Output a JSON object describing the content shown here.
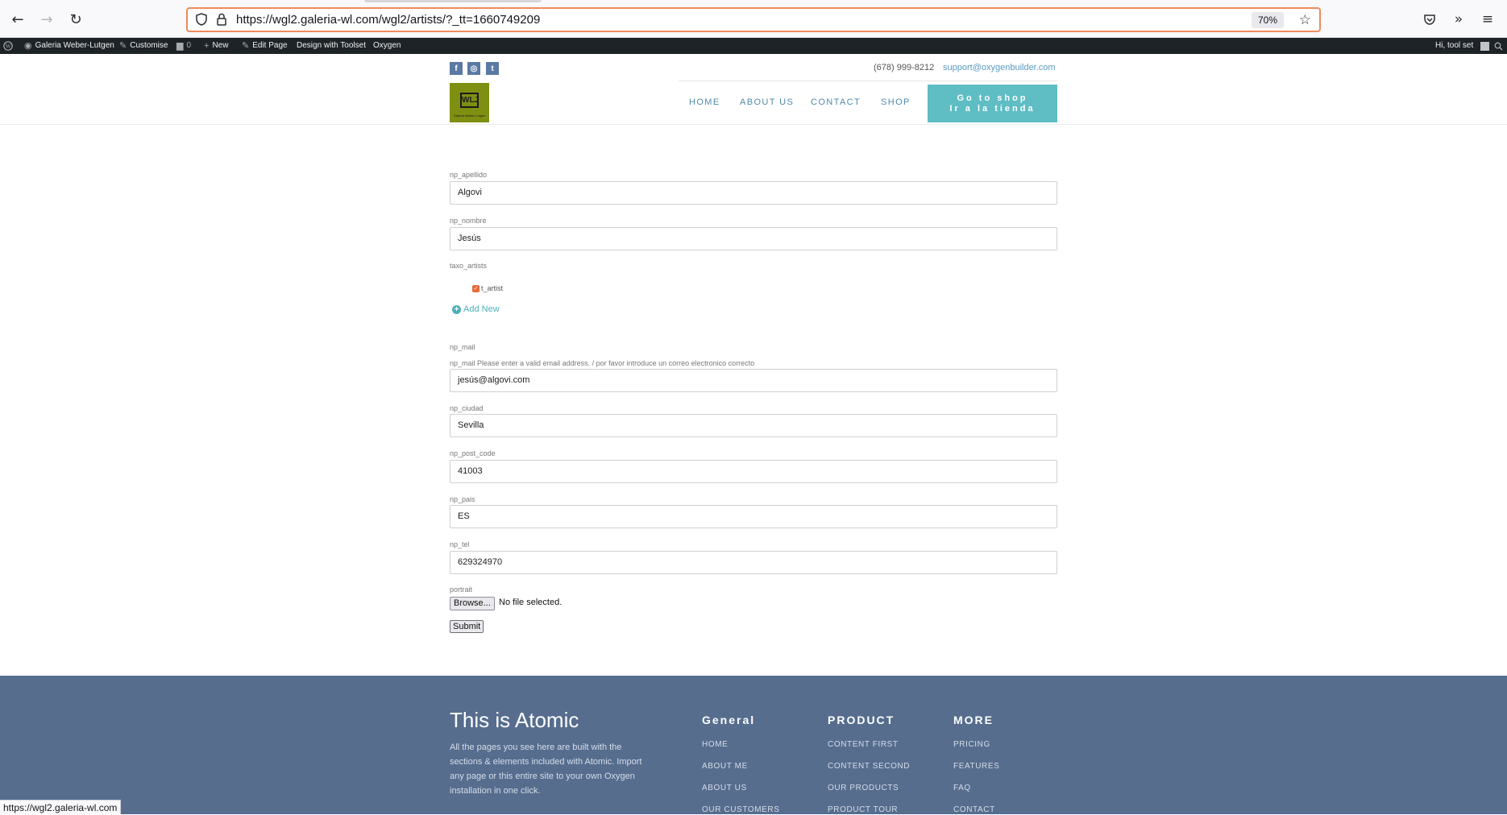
{
  "browser": {
    "url": "https://wgl2.galeria-wl.com/wgl2/artists/?_tt=1660749209",
    "zoom": "70%",
    "status_url": "https://wgl2.galeria-wl.com"
  },
  "admin_bar": {
    "site_name": "Galeria Weber-Lutgen",
    "customise": "Customise",
    "comments_count": "0",
    "new": "New",
    "edit_page": "Edit Page",
    "design_with_toolset": "Design with Toolset",
    "oxygen": "Oxygen",
    "greeting": "Hi, tool set"
  },
  "header": {
    "social": [
      "f",
      "◎",
      "t"
    ],
    "phone": "(678) 999-8212",
    "email": "support@oxygenbuilder.com",
    "logo_text": "WLJ",
    "logo_subtext": "Galería Weber-Lutgen",
    "nav": [
      "HOME",
      "ABOUT US",
      "CONTACT",
      "SHOP"
    ],
    "cta_line1": "Go to shop",
    "cta_line2": "Ir a la tienda"
  },
  "form": {
    "apellido_label": "np_apellido",
    "apellido_value": "Algovi",
    "nombre_label": "np_nombre",
    "nombre_value": "Jesús",
    "taxo_label": "taxo_artists",
    "taxo_option": "t_artist",
    "add_new": "Add New",
    "mail_heading": "np_mail",
    "mail_label": "np_mail Please enter a valid email address. / por favor introduce un correo electronico correcto",
    "mail_value": "jesús@algovi.com",
    "ciudad_label": "np_ciudad",
    "ciudad_value": "Sevilla",
    "post_code_label": "np_post_code",
    "post_code_value": "41003",
    "pais_label": "np_pais",
    "pais_value": "ES",
    "tel_label": "np_tel",
    "tel_value": "629324970",
    "portrait_label": "portrait",
    "browse": "Browse...",
    "file_status": "No file selected.",
    "submit": "Submit"
  },
  "footer": {
    "title": "This is Atomic",
    "text": "All the pages you see here are built with the sections & elements included with Atomic. Import any page or this entire site to your own Oxygen installation in one click.",
    "columns": [
      {
        "title": "General",
        "items": [
          "HOME",
          "ABOUT ME",
          "ABOUT US",
          "OUR CUSTOMERS"
        ]
      },
      {
        "title": "PRODUCT",
        "items": [
          "CONTENT FIRST",
          "CONTENT SECOND",
          "OUR PRODUCTS",
          "PRODUCT TOUR"
        ]
      },
      {
        "title": "MORE",
        "items": [
          "PRICING",
          "FEATURES",
          "FAQ",
          "CONTACT"
        ]
      }
    ]
  }
}
